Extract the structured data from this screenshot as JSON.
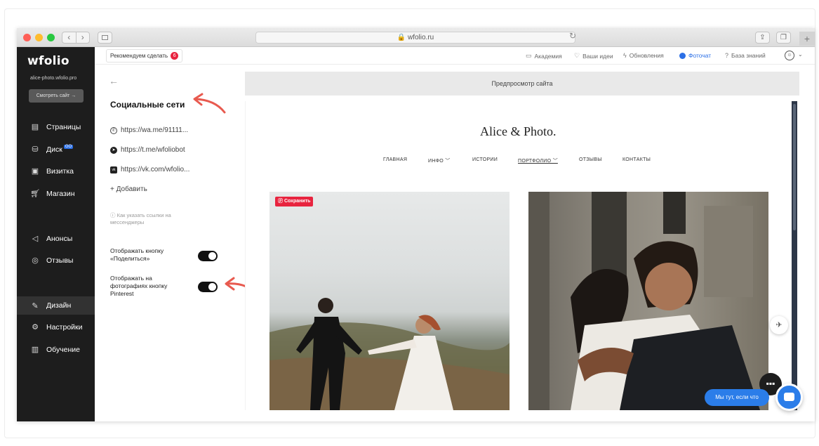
{
  "browser": {
    "url": "wfolio.ru",
    "nav_back": "‹",
    "nav_forward": "›",
    "reload": "↻",
    "new_tab": "+"
  },
  "sidebar": {
    "logo": "wfolio",
    "site_url": "alice-photo.wfolio.pro",
    "view_site": "Смотреть сайт →",
    "items": [
      {
        "label": "Страницы",
        "icon": "pages-icon"
      },
      {
        "label": "Диск",
        "icon": "disk-icon",
        "badge": "GO"
      },
      {
        "label": "Визитка",
        "icon": "card-icon"
      },
      {
        "label": "Магазин",
        "icon": "cart-icon"
      },
      {
        "label": "Анонсы",
        "icon": "megaphone-icon"
      },
      {
        "label": "Отзывы",
        "icon": "reviews-icon"
      },
      {
        "label": "Дизайн",
        "icon": "brush-icon"
      },
      {
        "label": "Настройки",
        "icon": "gear-icon"
      },
      {
        "label": "Обучение",
        "icon": "book-icon"
      }
    ]
  },
  "topbar": {
    "recommend": "Рекомендуем сделать",
    "recommend_count": "6",
    "links": {
      "academy": "Академия",
      "ideas": "Ваши идеи",
      "updates": "Обновления",
      "fotochat": "Фоточат",
      "knowledge": "База знаний"
    }
  },
  "panel": {
    "back": "←",
    "title": "Социальные сети",
    "links": [
      "https://wa.me/91111...",
      "https://t.me/wfoliobot",
      "https://vk.com/wfolio..."
    ],
    "add": "+ Добавить",
    "hint": "Как указать ссылки на мессенджеры",
    "toggles": [
      {
        "label": "Отображать кнопку «Поделиться»",
        "on": true
      },
      {
        "label": "Отображать на фотографиях кнопку Pinterest",
        "on": true
      }
    ]
  },
  "preview": {
    "bar_label": "Предпросмотр сайта",
    "site_logo": "Alice & Photo.",
    "nav": [
      "ГЛАВНАЯ",
      "ИНФО ﹀",
      "ИСТОРИИ",
      "ПОРТФОЛИО ﹀",
      "ОТЗЫВЫ",
      "КОНТАКТЫ"
    ],
    "save_button": "Сохранить",
    "chat_pill": "Мы тут, если что"
  },
  "colors": {
    "accent_blue": "#2b6fe6",
    "sidebar_bg": "#1d1d1d",
    "annotation_red": "#e85a4f",
    "pinterest_red": "#e8243f"
  }
}
